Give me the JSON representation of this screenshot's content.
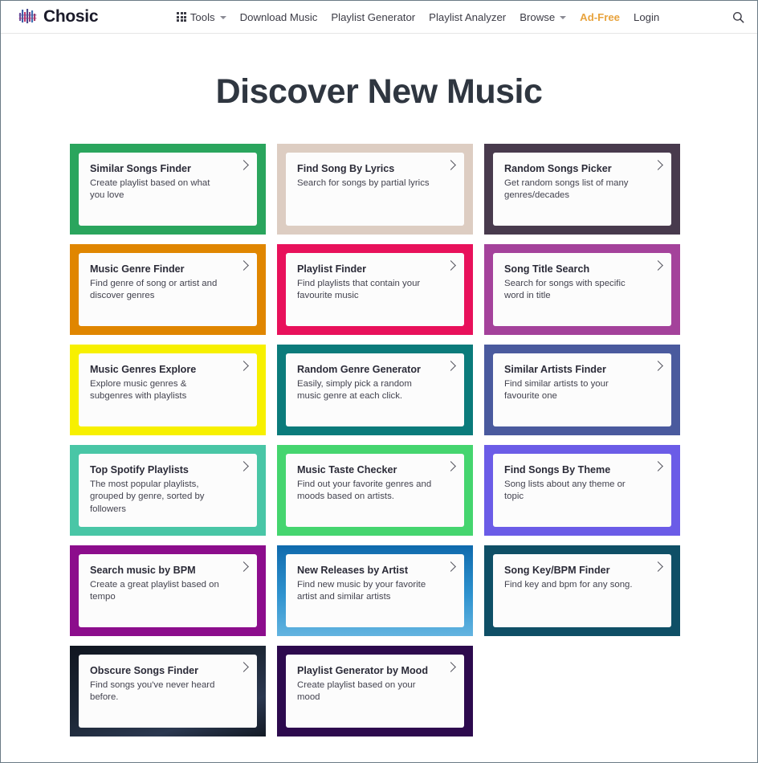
{
  "header": {
    "brand": "Chosic",
    "brand_icon": "equalizer-bars-icon",
    "nav": [
      {
        "label": "Tools",
        "icon": "grid-apps-icon",
        "caret": true,
        "accent": false
      },
      {
        "label": "Download Music",
        "icon": null,
        "caret": false,
        "accent": false
      },
      {
        "label": "Playlist Generator",
        "icon": null,
        "caret": false,
        "accent": false
      },
      {
        "label": "Playlist Analyzer",
        "icon": null,
        "caret": false,
        "accent": false
      },
      {
        "label": "Browse",
        "icon": null,
        "caret": true,
        "accent": false
      },
      {
        "label": "Ad-Free",
        "icon": null,
        "caret": false,
        "accent": true
      },
      {
        "label": "Login",
        "icon": null,
        "caret": false,
        "accent": false
      }
    ],
    "search_icon": "search-icon",
    "accent_color": "#e8a33d"
  },
  "page_title": "Discover New Music",
  "cards": [
    {
      "title": "Similar Songs Finder",
      "desc": "Create playlist based on what you love",
      "color": "#2aa55d"
    },
    {
      "title": "Find Song By Lyrics",
      "desc": "Search for songs by partial lyrics",
      "color": "#ddcdc2"
    },
    {
      "title": "Random Songs Picker",
      "desc": "Get random songs list of many genres/decades",
      "color": "#483a4d"
    },
    {
      "title": "Music Genre Finder",
      "desc": "Find genre of song or artist and discover genres",
      "color": "#e08600"
    },
    {
      "title": "Playlist Finder",
      "desc": "Find playlists that contain your favourite music",
      "color": "#e8115b"
    },
    {
      "title": "Song Title Search",
      "desc": "Search for songs with specific word in title",
      "color": "#a4429b"
    },
    {
      "title": "Music Genres Explore",
      "desc": "Explore music genres & subgenres with playlists",
      "color": "#f7f000"
    },
    {
      "title": "Random Genre Generator",
      "desc": "Easily, simply pick a random music genre at each click.",
      "color": "#0b7b7b"
    },
    {
      "title": "Similar Artists Finder",
      "desc": "Find similar artists to your favourite one",
      "color": "#4a5a9e"
    },
    {
      "title": "Top Spotify Playlists",
      "desc": "The most popular playlists, grouped by genre, sorted by followers",
      "color": "#49c6a6"
    },
    {
      "title": "Music Taste Checker",
      "desc": "Find out your favorite genres and moods based on artists.",
      "color": "#45d56f"
    },
    {
      "title": "Find Songs By Theme",
      "desc": "Song lists about any theme or topic",
      "color": "#6b5ce7"
    },
    {
      "title": "Search music by BPM",
      "desc": "Create a great playlist based on tempo",
      "color": "#8c0d8c"
    },
    {
      "title": "New Releases by Artist",
      "desc": "Find new music by your favorite artist and similar artists",
      "color": "#1a7fc1",
      "gradient": "linear-gradient(180deg,#0f6aad 0%,#2f93cf 55%,#63b4e0 100%)"
    },
    {
      "title": "Song Key/BPM Finder",
      "desc": "Find key and bpm for any song.",
      "color": "#0f4f66"
    },
    {
      "title": "Obscure Songs Finder",
      "desc": "Find songs you've never heard before.",
      "color": "#141b26",
      "gradient": "linear-gradient(160deg,#101620 0%,#1d2736 45%,#2b3850 75%,#131a25 100%)"
    },
    {
      "title": "Playlist Generator by Mood",
      "desc": "Create playlist based on your mood",
      "color": "#2d0a4e"
    }
  ]
}
